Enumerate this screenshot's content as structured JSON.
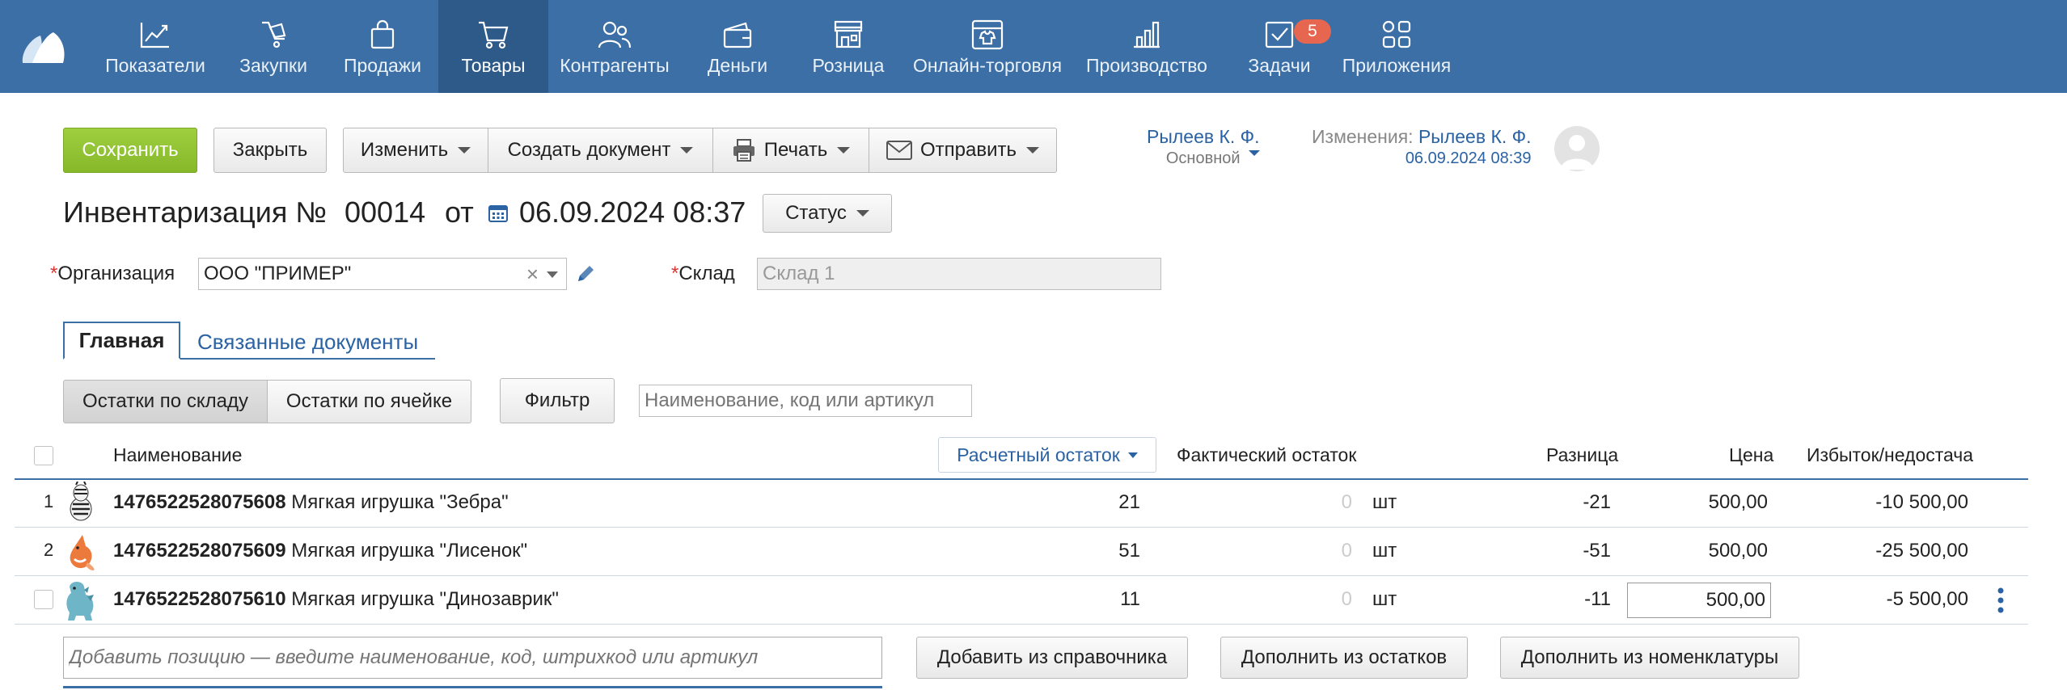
{
  "nav": {
    "items": [
      {
        "label": "Показатели",
        "icon": "chart-line-icon"
      },
      {
        "label": "Закупки",
        "icon": "purchase-bag-icon"
      },
      {
        "label": "Продажи",
        "icon": "shopping-bag-icon"
      },
      {
        "label": "Товары",
        "icon": "cart-icon"
      },
      {
        "label": "Контрагенты",
        "icon": "people-icon"
      },
      {
        "label": "Деньги",
        "icon": "wallet-icon"
      },
      {
        "label": "Розница",
        "icon": "store-icon"
      },
      {
        "label": "Онлайн-торговля",
        "icon": "online-store-icon"
      },
      {
        "label": "Производство",
        "icon": "factory-icon"
      },
      {
        "label": "Задачи",
        "icon": "task-check-icon"
      },
      {
        "label": "Приложения",
        "icon": "apps-grid-icon"
      }
    ],
    "active": "Товары",
    "tasks_badge": "5"
  },
  "toolbar": {
    "save": "Сохранить",
    "close": "Закрыть",
    "edit": "Изменить",
    "create_document": "Создать документ",
    "print": "Печать",
    "send": "Отправить"
  },
  "user": {
    "name": "Рылеев К. Ф.",
    "role": "Основной",
    "changes_label": "Изменения:",
    "changes_user": "Рылеев К. Ф.",
    "changes_date": "06.09.2024 08:39"
  },
  "document": {
    "title": "Инвентаризация №",
    "number": "00014",
    "from": "от",
    "datetime": "06.09.2024 08:37",
    "status": "Статус"
  },
  "form": {
    "org_label": "Организация",
    "org_value": "ООО \"ПРИМЕР\"",
    "warehouse_label": "Склад",
    "warehouse_placeholder": "Склад 1"
  },
  "tabs": {
    "main": "Главная",
    "related": "Связанные документы"
  },
  "filters": {
    "by_warehouse": "Остатки по складу",
    "by_cell": "Остатки по ячейке",
    "filter": "Фильтр",
    "search_placeholder": "Наименование, код или артикул"
  },
  "table": {
    "headers": {
      "name": "Наименование",
      "calc_balance": "Расчетный остаток",
      "actual_balance": "Фактический остаток",
      "difference": "Разница",
      "price": "Цена",
      "surplus": "Избыток/недостача"
    },
    "rows": [
      {
        "n": "1",
        "code": "1476522528075608",
        "name": "Мягкая игрушка \"Зебра\"",
        "calc": "21",
        "actual": "0",
        "unit": "шт",
        "diff": "-21",
        "price": "500,00",
        "surplus": "-10 500,00"
      },
      {
        "n": "2",
        "code": "1476522528075609",
        "name": "Мягкая игрушка \"Лисенок\"",
        "calc": "51",
        "actual": "0",
        "unit": "шт",
        "diff": "-51",
        "price": "500,00",
        "surplus": "-25 500,00"
      },
      {
        "n": "",
        "code": "1476522528075610",
        "name": "Мягкая игрушка \"Динозаврик\"",
        "calc": "11",
        "actual": "0",
        "unit": "шт",
        "diff": "-11",
        "price": "500,00",
        "surplus": "-5 500,00"
      }
    ]
  },
  "footer": {
    "add_placeholder": "Добавить позицию — введите наименование, код, штрихкод или артикул",
    "add_from_catalog": "Добавить из справочника",
    "fill_from_balances": "Дополнить из остатков",
    "fill_from_nomenclature": "Дополнить из номенклатуры"
  },
  "colors": {
    "nav_bg": "#3c6fa5",
    "nav_active": "#2e5a8a",
    "save_green": "#8cc031",
    "link_blue": "#2a62a3",
    "badge": "#e7664f"
  }
}
